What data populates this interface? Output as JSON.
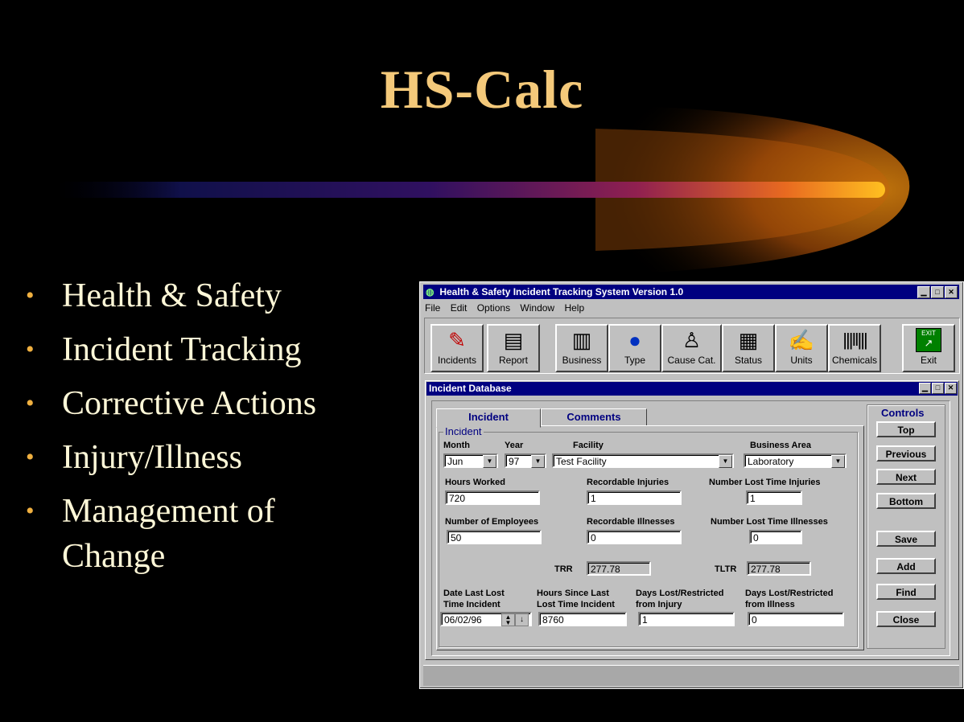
{
  "slide": {
    "title": "HS-Calc",
    "bullets": [
      "Health & Safety",
      "Incident Tracking",
      "Corrective Actions",
      "Injury/Illness",
      "Management of Change"
    ]
  },
  "window": {
    "title": "Health & Safety Incident Tracking System  Version 1.0",
    "menu": [
      "File",
      "Edit",
      "Options",
      "Window",
      "Help"
    ],
    "toolbar": [
      {
        "label": "Incidents",
        "icon": "incidents-icon"
      },
      {
        "label": "Report",
        "icon": "report-icon"
      },
      {
        "label": "Business",
        "icon": "business-icon"
      },
      {
        "label": "Type",
        "icon": "globe-icon"
      },
      {
        "label": "Cause Cat.",
        "icon": "person-icon"
      },
      {
        "label": "Status",
        "icon": "status-icon"
      },
      {
        "label": "Units",
        "icon": "units-icon"
      },
      {
        "label": "Chemicals",
        "icon": "barcode-icon"
      },
      {
        "label": "Exit",
        "icon": "exit-icon",
        "badge": "EXIT"
      }
    ]
  },
  "child": {
    "title": "Incident Database",
    "tabs": [
      "Incident",
      "Comments"
    ],
    "group_title": "Incident",
    "fields": {
      "month_label": "Month",
      "month": "Jun",
      "year_label": "Year",
      "year": "97",
      "facility_label": "Facility",
      "facility": "Test Facility",
      "business_area_label": "Business Area",
      "business_area": "Laboratory",
      "hours_worked_label": "Hours Worked",
      "hours_worked": "720",
      "recordable_injuries_label": "Recordable Injuries",
      "recordable_injuries": "1",
      "lost_time_injuries_label": "Number Lost Time Injuries",
      "lost_time_injuries": "1",
      "employees_label": "Number of Employees",
      "employees": "50",
      "recordable_illnesses_label": "Recordable Illnesses",
      "recordable_illnesses": "0",
      "lost_time_illnesses_label": "Number Lost Time Illnesses",
      "lost_time_illnesses": "0",
      "trr_label": "TRR",
      "trr": "277.78",
      "tltr_label": "TLTR",
      "tltr": "277.78",
      "date_last_label_1": "Date Last Lost",
      "date_last_label_2": "Time Incident",
      "date_last": "06/02/96",
      "hours_since_label_1": "Hours Since Last",
      "hours_since_label_2": "Lost Time Incident",
      "hours_since": "8760",
      "days_injury_label_1": "Days Lost/Restricted",
      "days_injury_label_2": "from Injury",
      "days_injury": "1",
      "days_illness_label_1": "Days Lost/Restricted",
      "days_illness_label_2": "from Illness",
      "days_illness": "0"
    },
    "controls_title": "Controls",
    "controls": [
      "Top",
      "Previous",
      "Next",
      "Bottom",
      "Save",
      "Add",
      "Find",
      "Close"
    ]
  },
  "colors": {
    "title": "#f4c97a",
    "titlebar": "#000080",
    "bullet_dot": "#f0b040"
  }
}
